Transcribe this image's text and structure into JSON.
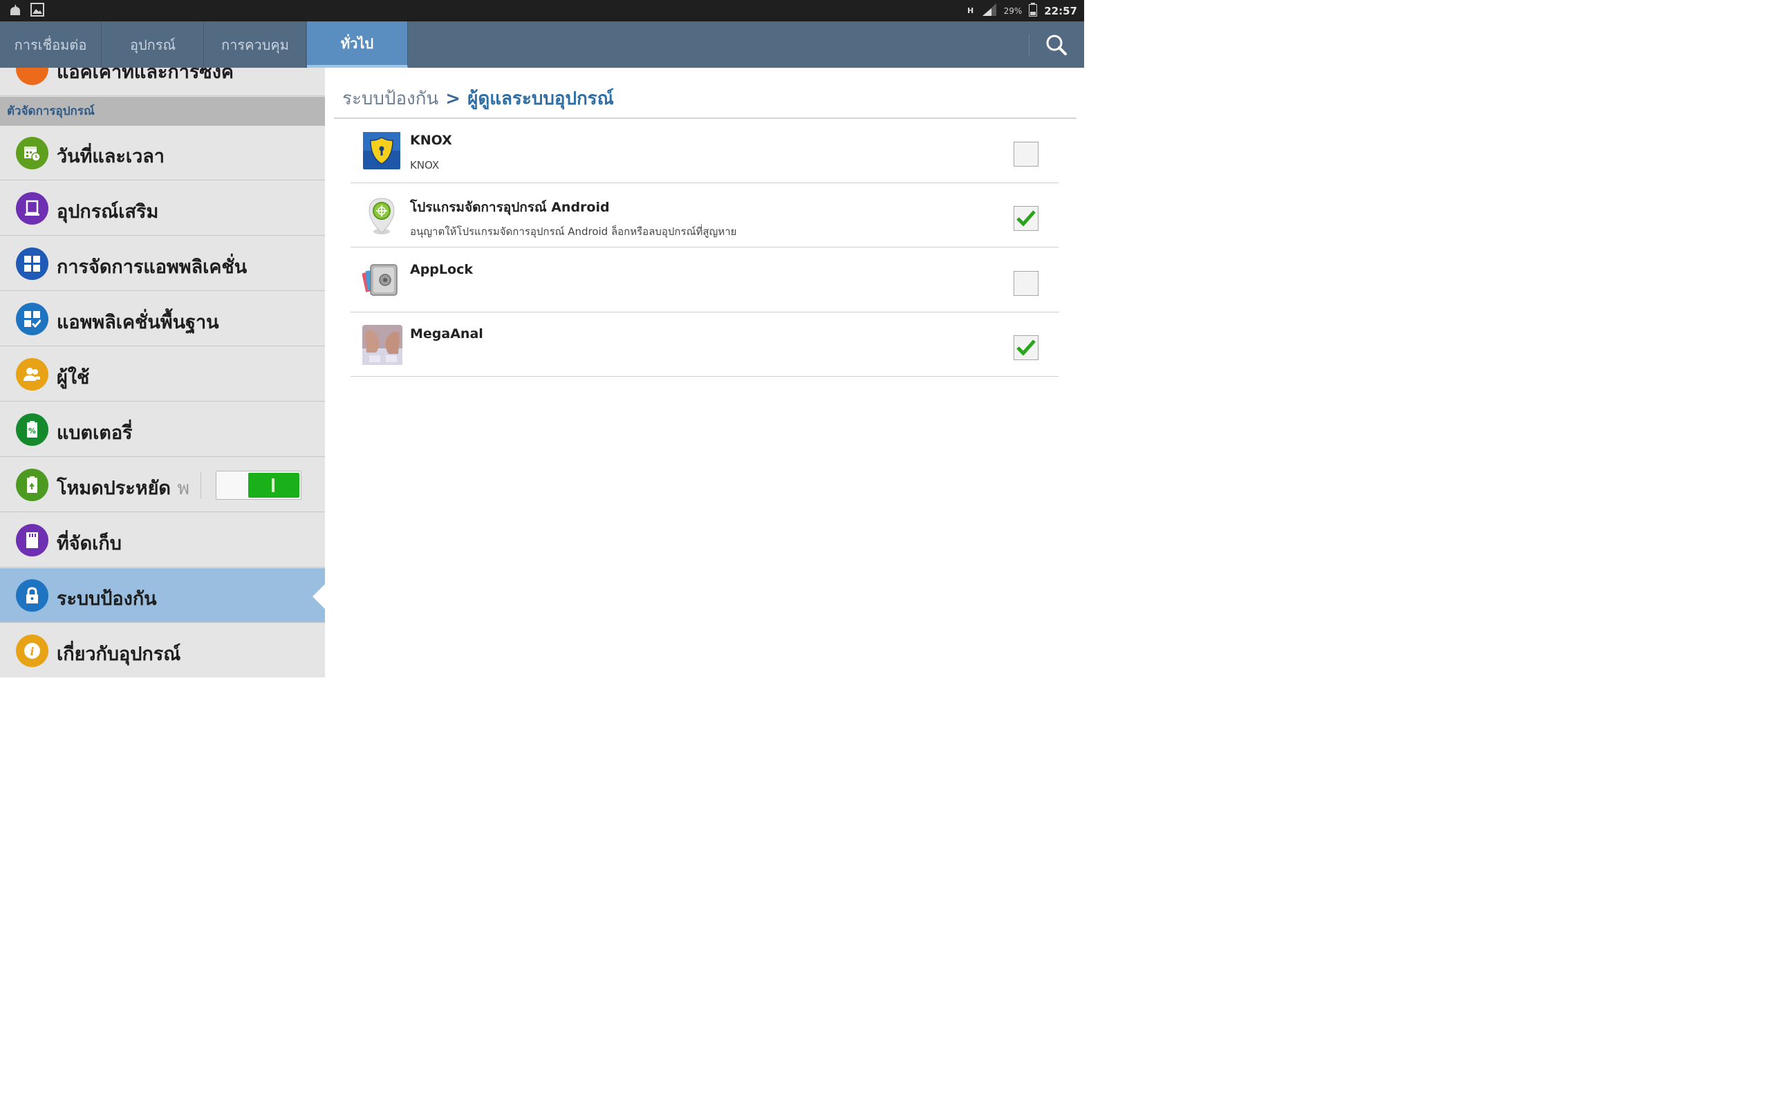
{
  "status_bar": {
    "network": "H",
    "battery": "29%",
    "time": "22:57"
  },
  "tabs": [
    {
      "label": "การเชื่อมต่อ",
      "active": false
    },
    {
      "label": "อุปกรณ์",
      "active": false
    },
    {
      "label": "การควบคุม",
      "active": false
    },
    {
      "label": "ทั่วไป",
      "active": true
    }
  ],
  "sidebar": {
    "top_partial_label": "แอคเคาท์และการซิงค์",
    "section_header": "ตัวจัดการอุปกรณ์",
    "items": [
      {
        "label": "วันที่และเวลา",
        "icon": "calendar-clock-icon",
        "color": "#5ea01e"
      },
      {
        "label": "อุปกรณ์เสริม",
        "icon": "device-icon",
        "color": "#6f2fb3"
      },
      {
        "label": "การจัดการแอพพลิเคชั่น",
        "icon": "grid-icon",
        "color": "#1f5bb6"
      },
      {
        "label": "แอพพลิเคชั่นพื้นฐาน",
        "icon": "grid-check-icon",
        "color": "#1f74c2"
      },
      {
        "label": "ผู้ใช้",
        "icon": "users-icon",
        "color": "#e8a215"
      },
      {
        "label": "แบตเตอรี่",
        "icon": "battery-icon",
        "color": "#158a2c"
      },
      {
        "label": "โหมดประหยัด",
        "label_fade": "พ",
        "icon": "power-saving-icon",
        "color": "#4d9a22",
        "toggle_on": true
      },
      {
        "label": "ที่จัดเก็บ",
        "icon": "storage-icon",
        "color": "#6f2fb3"
      },
      {
        "label": "ระบบป้องกัน",
        "icon": "lock-icon",
        "color": "#1f74c2",
        "selected": true
      },
      {
        "label": "เกี่ยวกับอุปกรณ์",
        "icon": "info-icon",
        "color": "#e8a215"
      }
    ]
  },
  "content": {
    "breadcrumb_parent": "ระบบป้องกัน",
    "breadcrumb_sep": ">",
    "breadcrumb_current": "ผู้ดูแลระบบอุปกรณ์",
    "admins": [
      {
        "title": "KNOX",
        "subtitle": "KNOX",
        "icon": "knox-shield-icon",
        "checked": false
      },
      {
        "title": "โปรแกรมจัดการอุปกรณ์ Android",
        "subtitle": "อนุญาตให้โปรแกรมจัดการอุปกรณ์ Android ล็อกหรือลบอุปกรณ์ที่สูญหาย",
        "icon": "location-pin-icon",
        "checked": true
      },
      {
        "title": "AppLock",
        "subtitle": "",
        "icon": "safe-icon",
        "checked": false
      },
      {
        "title": "MegaAnal",
        "subtitle": "",
        "icon": "app-thumbnail-icon",
        "checked": true
      }
    ]
  }
}
